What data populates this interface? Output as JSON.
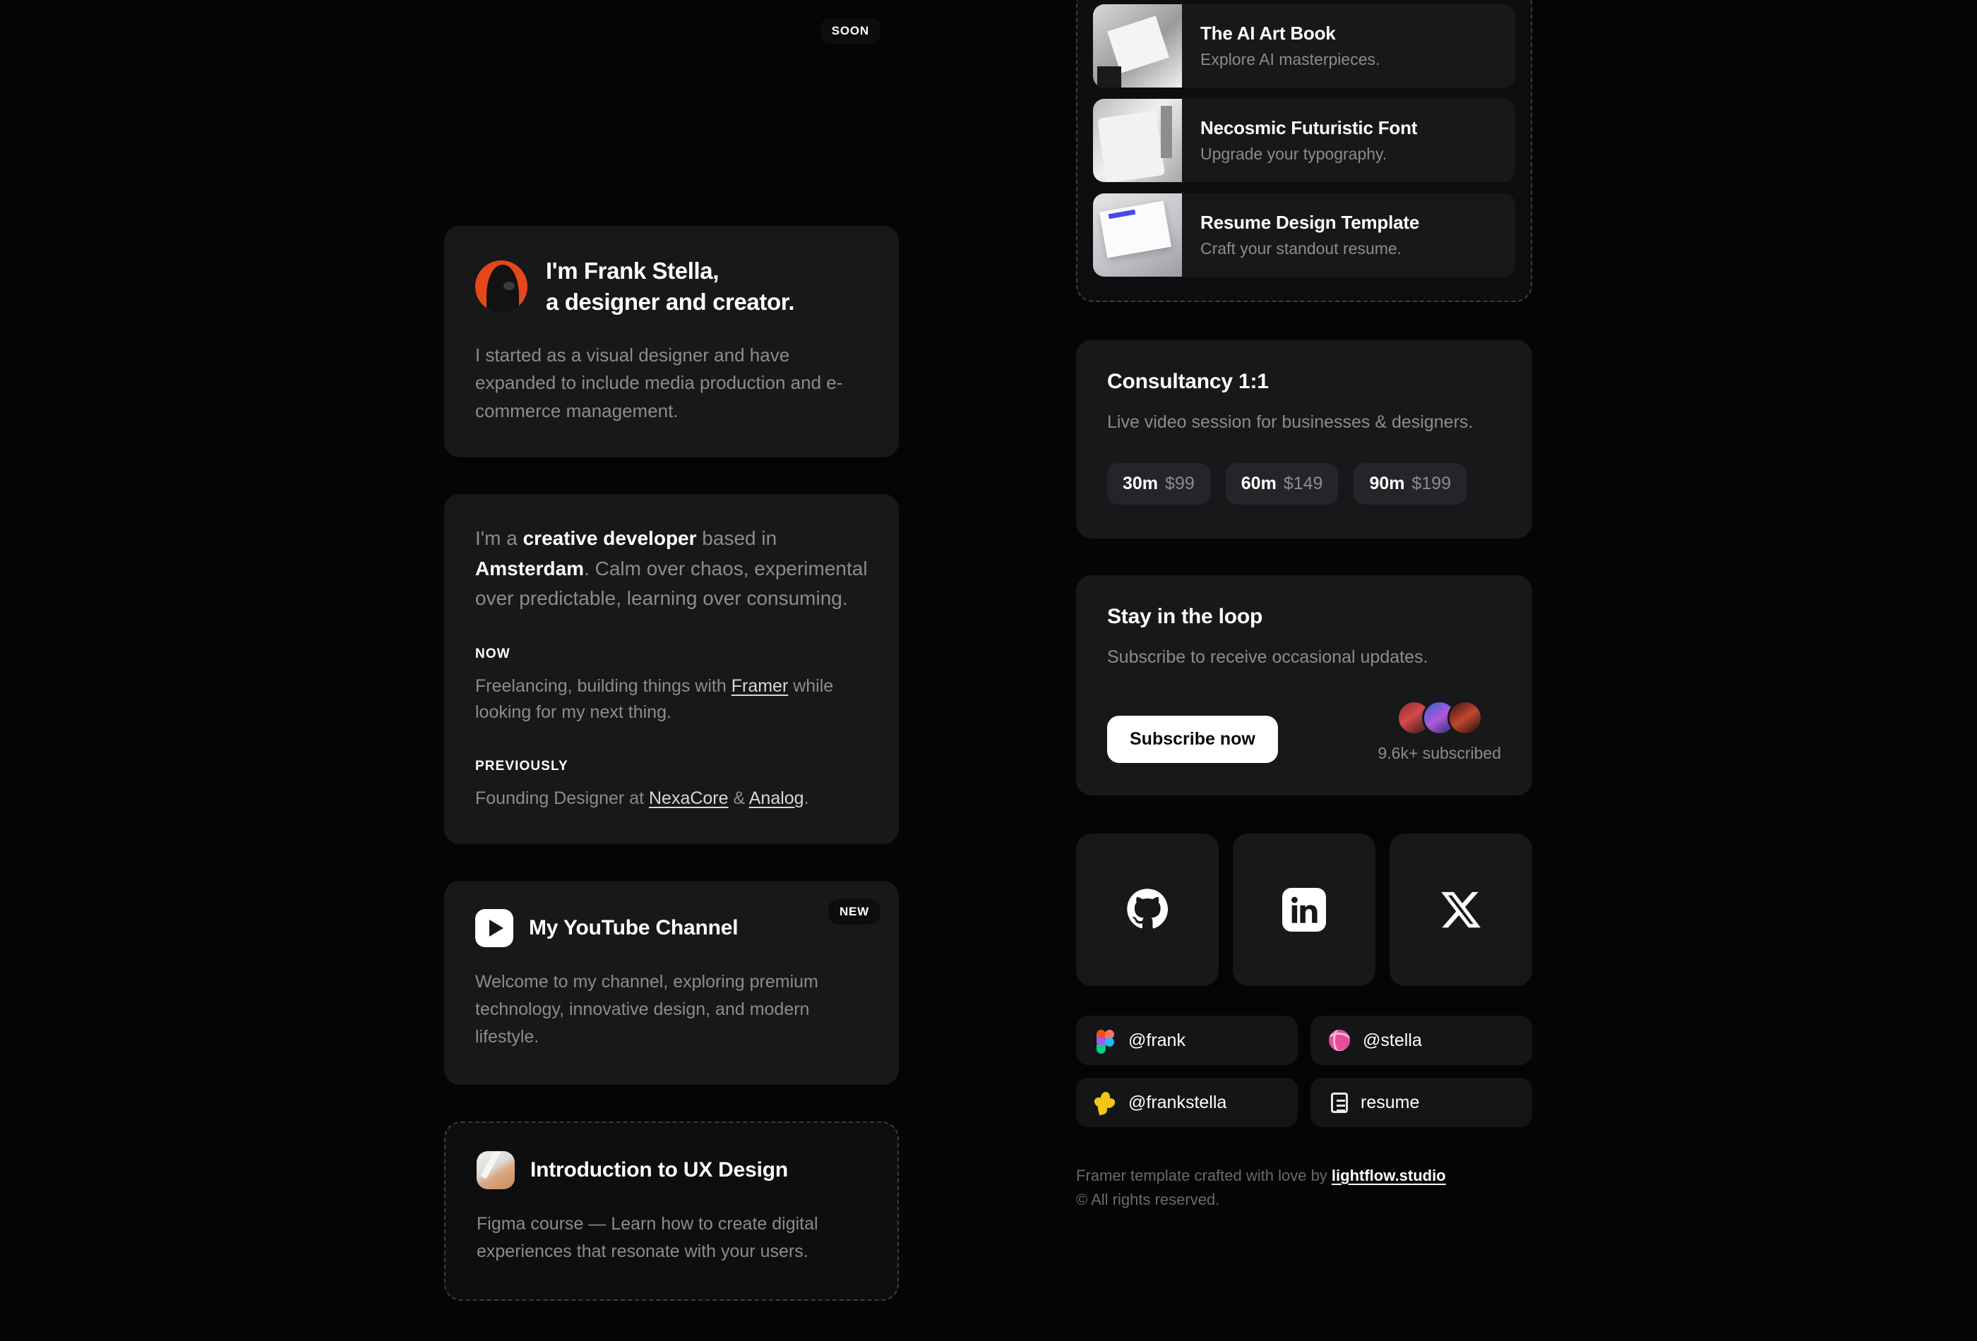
{
  "hero": {
    "title_line1": "I'm Frank Stella,",
    "title_line2": "a designer and creator.",
    "paragraph": "I started as a visual designer and have expanded to include media production and e-commerce management.",
    "avatar_icon": "portrait-avatar",
    "avatar_bg": "#e5471b"
  },
  "bio": {
    "lead_pre": "I'm a ",
    "lead_strong1": "creative developer",
    "lead_mid": " based in ",
    "lead_strong2": "Amsterdam",
    "lead_post": ". Calm over chaos, experimental over predictable, learning over consuming.",
    "now_label": "NOW",
    "now_pre": "Freelancing, building things with ",
    "now_link": "Framer",
    "now_post": " while looking for my next thing.",
    "prev_label": "PREVIOUSLY",
    "prev_pre": "Founding Designer at ",
    "prev_link1": "NexaCore",
    "prev_amp": " & ",
    "prev_link2": "Analog",
    "prev_post": "."
  },
  "youtube": {
    "badge": "NEW",
    "title": "My YouTube Channel",
    "icon": "youtube-play-icon",
    "body": "Welcome to my channel, exploring premium technology, innovative design, and modern lifestyle."
  },
  "course": {
    "badge": "SOON",
    "title": "Introduction to UX Design",
    "icon": "hand-writing-icon",
    "body": "Figma course — Learn how to create digital experiences that resonate with your users."
  },
  "products": [
    {
      "title": "The AI Art Book",
      "subtitle": "Explore AI masterpieces.",
      "thumb": "ai-art-book-thumb"
    },
    {
      "title": "Necosmic Futuristic Font",
      "subtitle": "Upgrade your typography.",
      "thumb": "necosmic-font-thumb"
    },
    {
      "title": "Resume Design Template",
      "subtitle": "Craft your standout resume.",
      "thumb": "resume-template-thumb"
    }
  ],
  "consultancy": {
    "title": "Consultancy 1:1",
    "subtitle": "Live video session for businesses & designers.",
    "options": [
      {
        "duration": "30m",
        "price": "$99"
      },
      {
        "duration": "60m",
        "price": "$149"
      },
      {
        "duration": "90m",
        "price": "$199"
      }
    ]
  },
  "newsletter": {
    "title": "Stay in the loop",
    "subtitle": "Subscribe to receive occasional updates.",
    "button": "Subscribe now",
    "count": "9.6k+ subscribed"
  },
  "socials": [
    {
      "name": "github",
      "label": "GitHub"
    },
    {
      "name": "linkedin",
      "label": "LinkedIn"
    },
    {
      "name": "x",
      "label": "X"
    }
  ],
  "handles": [
    {
      "label": "@frank",
      "icon": "figma-icon"
    },
    {
      "label": "@stella",
      "icon": "dribbble-icon"
    },
    {
      "label": "@frankstella",
      "icon": "gumroad-icon"
    },
    {
      "label": "resume",
      "icon": "document-icon"
    }
  ],
  "footer": {
    "pre": "Framer template crafted with love by ",
    "link": "lightflow.studio",
    "copyright": "© All rights reserved."
  }
}
